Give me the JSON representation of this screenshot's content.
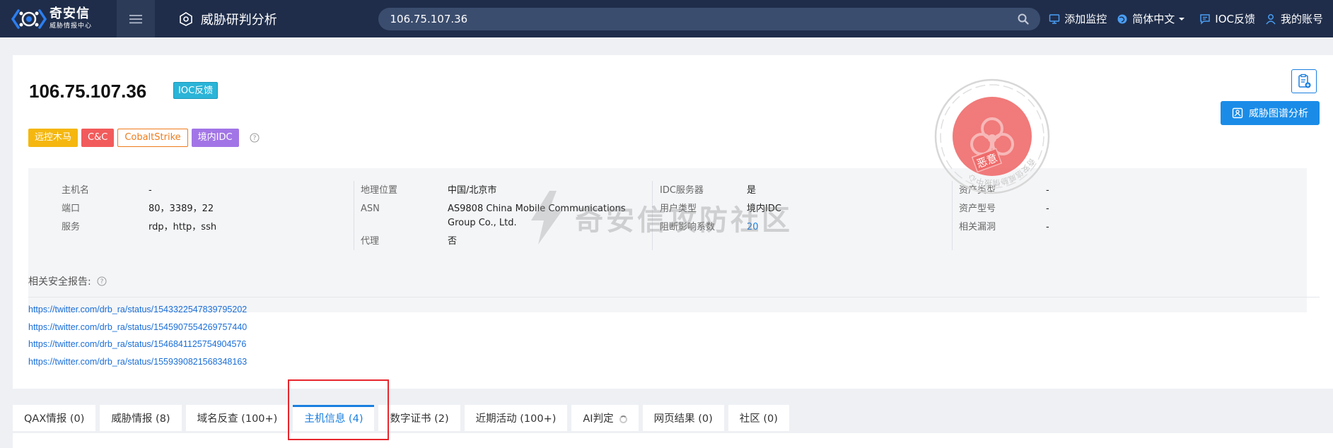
{
  "brand": {
    "name": "奇安信",
    "sub": "威胁情报中心"
  },
  "app": {
    "title": "威胁研判分析"
  },
  "search": {
    "value": "106.75.107.36"
  },
  "nav": {
    "add_monitor": "添加监控",
    "language": "简体中文",
    "ioc_feedback": "IOC反馈",
    "account": "我的账号"
  },
  "result": {
    "ip": "106.75.107.36",
    "ioc_badge": "IOC反馈",
    "tags": [
      {
        "label": "远控木马",
        "bg": "#f5b70f",
        "color": "#ffffff"
      },
      {
        "label": "C&C",
        "bg": "#f25b5b",
        "color": "#ffffff"
      },
      {
        "label": "CobaltStrike",
        "bg": "#ffffff",
        "color": "#ef7b1b"
      },
      {
        "label": "境内IDC",
        "bg": "#a275e6",
        "color": "#ffffff"
      }
    ],
    "info": {
      "col1": [
        {
          "k": "主机名",
          "v": "-"
        },
        {
          "k": "端口",
          "v": "80，3389，22"
        },
        {
          "k": "服务",
          "v": "rdp，http，ssh"
        }
      ],
      "col2": [
        {
          "k": "地理位置",
          "v": "中国/北京市"
        },
        {
          "k": "ASN",
          "v": "AS9808 China Mobile Communications Group Co., Ltd."
        },
        {
          "k": "代理",
          "v": "否"
        }
      ],
      "col3": [
        {
          "k": "IDC服务器",
          "v": "是"
        },
        {
          "k": "用户类型",
          "v": "境内IDC"
        },
        {
          "k": "阻断影响系数",
          "v": "20"
        }
      ],
      "col4": [
        {
          "k": "资产类型",
          "v": "-"
        },
        {
          "k": "资产型号",
          "v": "-"
        },
        {
          "k": "相关漏洞",
          "v": "-"
        }
      ]
    },
    "stamp_text": "恶意",
    "stamp_ring": "奇安信威胁情报中心",
    "watermark": "奇安信攻防社区",
    "graph_button": "威胁图谱分析",
    "reports_label": "相关安全报告:",
    "reports": [
      "https://twitter.com/drb_ra/status/1543322547839795202",
      "https://twitter.com/drb_ra/status/1545907554269757440",
      "https://twitter.com/drb_ra/status/1546841125754904576",
      "https://twitter.com/drb_ra/status/1559390821568348163"
    ]
  },
  "tabs": [
    {
      "label": "QAX情报 (0)",
      "active": false
    },
    {
      "label": "威胁情报 (8)",
      "active": false
    },
    {
      "label": "域名反查 (100+)",
      "active": false
    },
    {
      "label": "主机信息 (4)",
      "active": true
    },
    {
      "label": "数字证书 (2)",
      "active": false
    },
    {
      "label": "近期活动 (100+)",
      "active": false
    },
    {
      "label": "AI判定",
      "active": false,
      "loading": true
    },
    {
      "label": "网页结果 (0)",
      "active": false
    },
    {
      "label": "社区 (0)",
      "active": false
    }
  ],
  "colors": {
    "topbar": "#1f2d4a",
    "accent": "#1a7fe0",
    "highlight": "#e8262d",
    "stamp": "#e84c4c"
  }
}
